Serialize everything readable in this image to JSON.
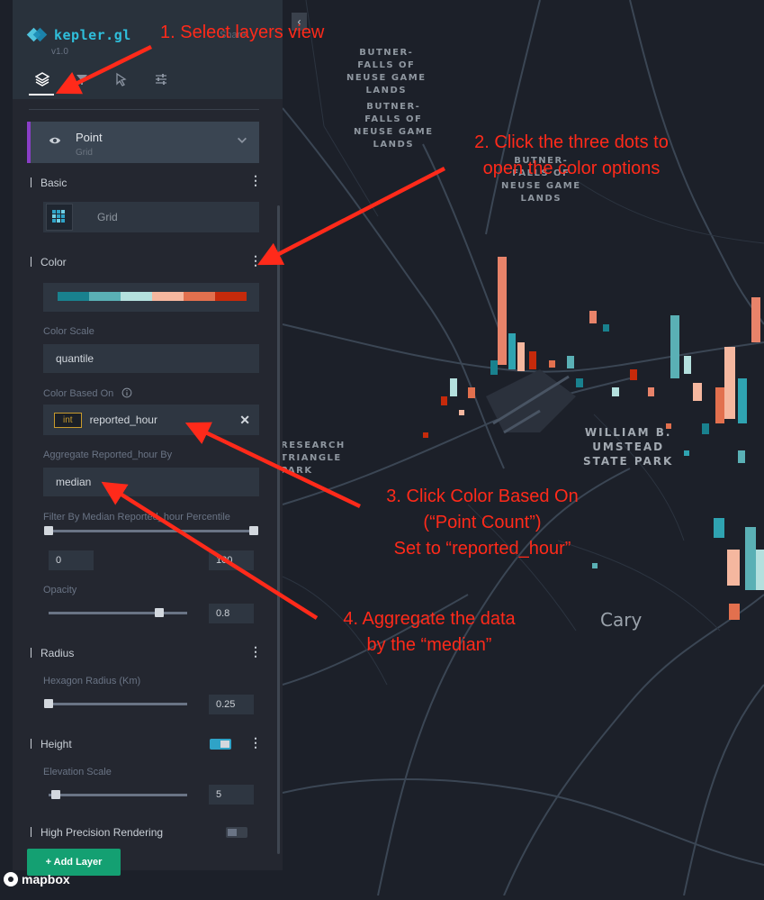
{
  "app": {
    "logo": "kepler.gl",
    "version": "v1.0",
    "share_ghost": "Share"
  },
  "tabs": [
    {
      "name": "layers",
      "icon": "layers-icon"
    },
    {
      "name": "filters",
      "icon": "filter-icon"
    },
    {
      "name": "interactions",
      "icon": "cursor-icon"
    },
    {
      "name": "map-settings",
      "icon": "sliders-icon"
    }
  ],
  "layer": {
    "name": "Point",
    "type": "Grid"
  },
  "basic": {
    "title": "Basic",
    "vis_type": "Grid"
  },
  "color": {
    "title": "Color",
    "palette": [
      "#19818e",
      "#5ab0b5",
      "#b4e0de",
      "#f5b79f",
      "#e2704e",
      "#c62a0b"
    ],
    "scale_label": "Color Scale",
    "scale_value": "quantile",
    "based_on_label": "Color Based On",
    "based_on_type": "int",
    "based_on_field": "reported_hour",
    "aggregate_label": "Aggregate Reported_hour By",
    "aggregate_value": "median",
    "filter_label": "Filter By Median Reported_hour Percentile",
    "filter_min": "0",
    "filter_max": "100",
    "opacity_label": "Opacity",
    "opacity_value": "0.8",
    "opacity_fraction": 0.8
  },
  "radius": {
    "title": "Radius",
    "label": "Hexagon Radius (Km)",
    "value": "0.25",
    "fraction": 0.0
  },
  "height": {
    "title": "Height",
    "label": "Elevation Scale",
    "value": "5",
    "fraction": 0.05
  },
  "precision": {
    "title": "High Precision Rendering",
    "enabled": false
  },
  "add_layer": "+ Add Layer",
  "mapbox": "mapbox",
  "map": {
    "labels": [
      "BUTNER-\nFALLS OF\nNEUSE GAME\nLANDS",
      "BUTNER-\nFALLS OF\nNEUSE GAME\nLANDS",
      "BUTNER-\nFALLS OF\nNEUSE GAME\nLANDS",
      "WILLIAM B.\nUMSTEAD\nSTATE PARK",
      "RESEARCH\nTRIANGLE\nPARK"
    ],
    "city": "Cary"
  },
  "annotations": [
    "1. Select layers view",
    "2. Click the three dots to\nopen the color options",
    "3. Click Color Based On\n(“Point Count”)\nSet to “reported_hour”",
    "4. Aggregate the data\nby the “median”"
  ],
  "colors": {
    "panel": "#242730",
    "accent": "#1fbad6",
    "annotation": "#ff2a1a",
    "layer_bar": "#8a3ec7"
  }
}
